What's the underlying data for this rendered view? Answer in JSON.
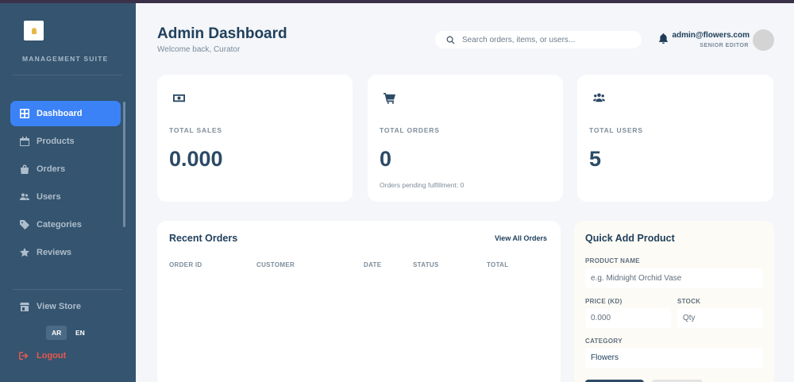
{
  "sidebar": {
    "brand": "MANAGEMENT SUITE",
    "items": [
      {
        "label": "Dashboard",
        "icon": "grid-icon"
      },
      {
        "label": "Products",
        "icon": "calendar-icon"
      },
      {
        "label": "Orders",
        "icon": "bag-icon"
      },
      {
        "label": "Users",
        "icon": "users-icon"
      },
      {
        "label": "Categories",
        "icon": "tag-icon"
      },
      {
        "label": "Reviews",
        "icon": "star-icon"
      }
    ],
    "view_store": "View Store",
    "lang_ar": "AR",
    "lang_en": "EN",
    "logout": "Logout"
  },
  "header": {
    "title": "Admin Dashboard",
    "subtitle": "Welcome back, Curator",
    "search_placeholder": "Search orders, items, or users...",
    "user_email": "admin@flowers.com",
    "user_role": "SENIOR EDITOR"
  },
  "stats": [
    {
      "label": "TOTAL SALES",
      "value": "0.000",
      "icon": "cash-icon"
    },
    {
      "label": "TOTAL ORDERS",
      "value": "0",
      "note": "Orders pending fulfillment: 0",
      "icon": "cart-icon"
    },
    {
      "label": "TOTAL USERS",
      "value": "5",
      "icon": "users-icon"
    }
  ],
  "orders": {
    "title": "Recent Orders",
    "view_all": "View All Orders",
    "columns": [
      "ORDER ID",
      "CUSTOMER",
      "DATE",
      "STATUS",
      "TOTAL"
    ]
  },
  "quick_add": {
    "title": "Quick Add Product",
    "name_label": "PRODUCT NAME",
    "name_placeholder": "e.g. Midnight Orchid Vase",
    "price_label": "PRICE (KD)",
    "price_placeholder": "0.000",
    "stock_label": "STOCK",
    "stock_placeholder": "Qty",
    "category_label": "CATEGORY",
    "category_value": "Flowers"
  },
  "colors": {
    "sidebar_bg": "#34546f",
    "accent": "#3b82f6",
    "logout": "#e8584f",
    "page_bg": "#f4f6f9"
  }
}
